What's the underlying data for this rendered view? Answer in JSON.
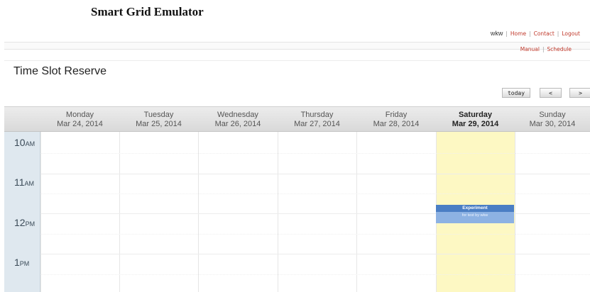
{
  "app_title": "Smart Grid Emulator",
  "top_nav": {
    "user": "wkw",
    "home": "Home",
    "contact": "Contact",
    "logout": "Logout"
  },
  "sub_nav": {
    "manual": "Manual",
    "schedule": "Schedule"
  },
  "section_title": "Time Slot Reserve",
  "toolbar": {
    "today": "today",
    "prev": "<",
    "next": ">"
  },
  "days": [
    {
      "name": "Monday",
      "date": "Mar 24, 2014"
    },
    {
      "name": "Tuesday",
      "date": "Mar 25, 2014"
    },
    {
      "name": "Wednesday",
      "date": "Mar 26, 2014"
    },
    {
      "name": "Thursday",
      "date": "Mar 27, 2014"
    },
    {
      "name": "Friday",
      "date": "Mar 28, 2014"
    },
    {
      "name": "Saturday",
      "date": "Mar 29, 2014"
    },
    {
      "name": "Sunday",
      "date": "Mar 30, 2014"
    }
  ],
  "hours": [
    {
      "h": "10",
      "ampm": "AM"
    },
    {
      "h": "11",
      "ampm": "AM"
    },
    {
      "h": "12",
      "ampm": "PM"
    },
    {
      "h": "1",
      "ampm": "PM"
    }
  ],
  "event": {
    "title": "Experiment",
    "description": "for test by wkw"
  },
  "colors": {
    "today_bg": "#fdf8c3",
    "event_bg": "#4a7ec4",
    "link": "#c0392b",
    "gutter": "#dfe8ef"
  }
}
